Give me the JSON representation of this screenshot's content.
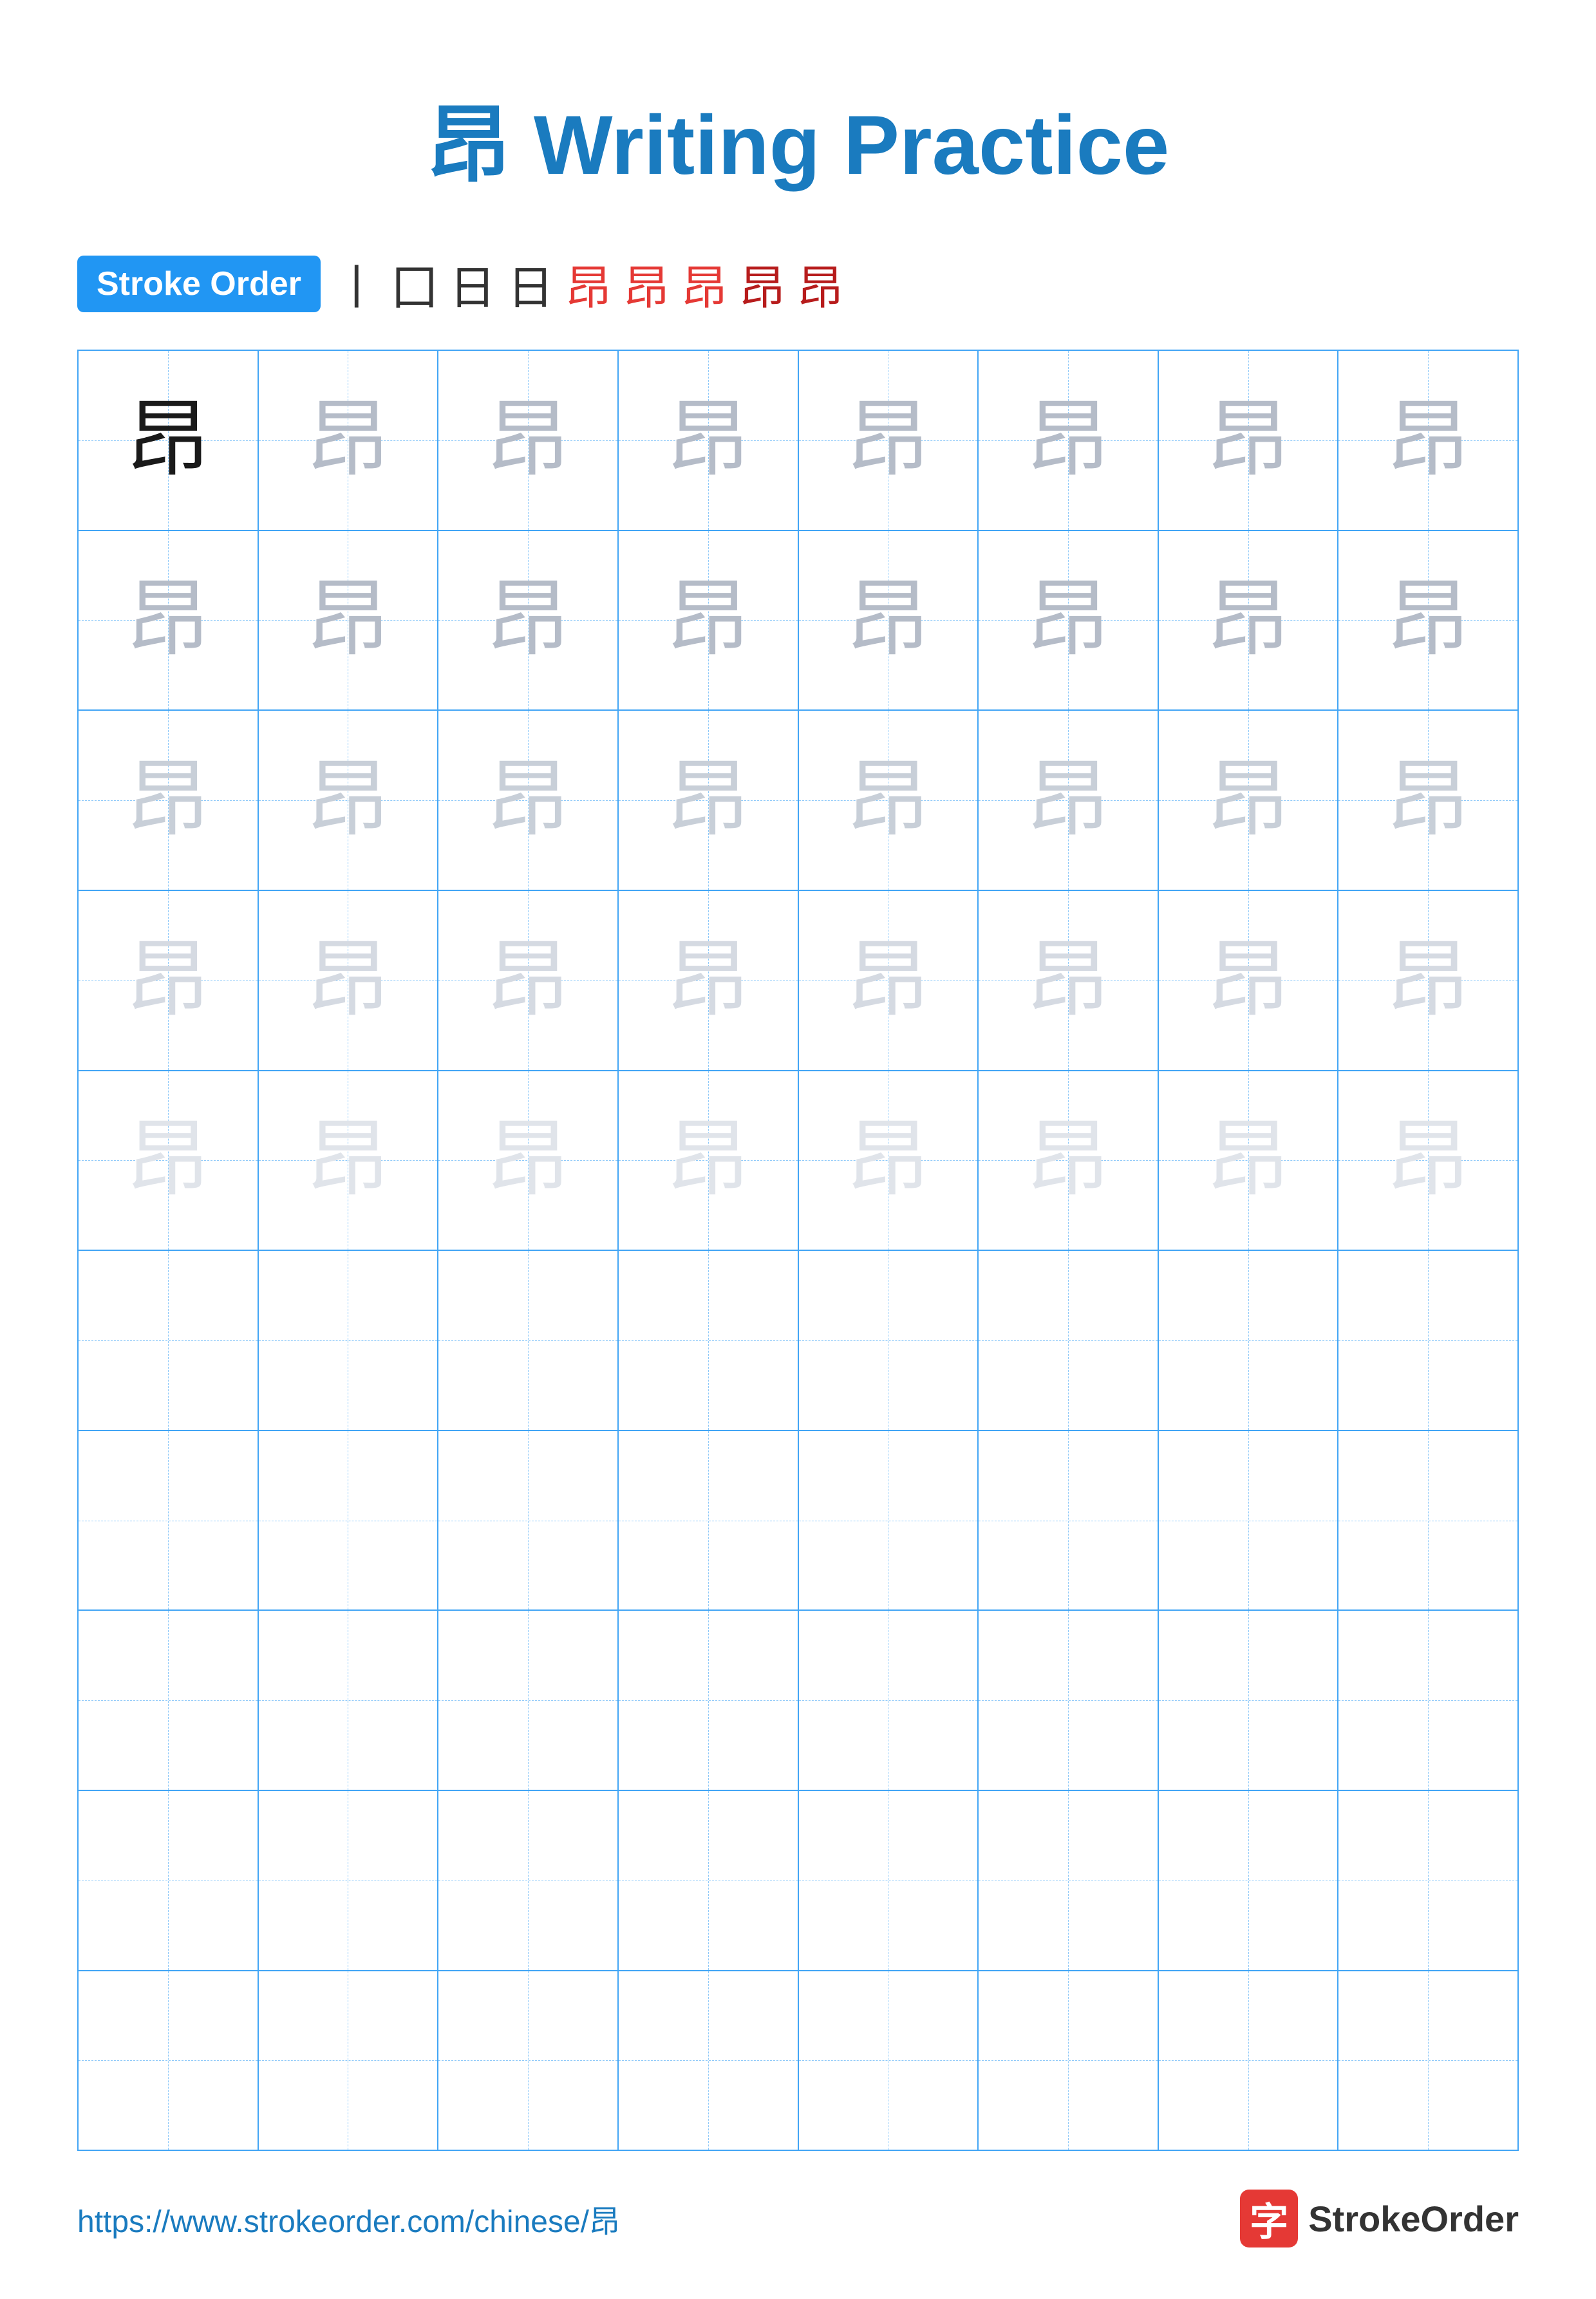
{
  "title": {
    "char": "昂",
    "text": " Writing Practice"
  },
  "stroke_order": {
    "badge_label": "Stroke Order",
    "steps": [
      "丨",
      "囗",
      "日",
      "日",
      "昂",
      "昂",
      "昂",
      "昂",
      "昂"
    ]
  },
  "grid": {
    "rows": 10,
    "cols": 8,
    "char": "昂",
    "practice_rows": [
      [
        "black",
        "gray1",
        "gray1",
        "gray1",
        "gray1",
        "gray1",
        "gray1",
        "gray1"
      ],
      [
        "gray1",
        "gray1",
        "gray1",
        "gray1",
        "gray1",
        "gray1",
        "gray1",
        "gray1"
      ],
      [
        "gray2",
        "gray2",
        "gray2",
        "gray2",
        "gray2",
        "gray2",
        "gray2",
        "gray2"
      ],
      [
        "gray3",
        "gray3",
        "gray3",
        "gray3",
        "gray3",
        "gray3",
        "gray3",
        "gray3"
      ],
      [
        "gray4",
        "gray4",
        "gray4",
        "gray4",
        "gray4",
        "gray4",
        "gray4",
        "gray4"
      ],
      [
        "empty",
        "empty",
        "empty",
        "empty",
        "empty",
        "empty",
        "empty",
        "empty"
      ],
      [
        "empty",
        "empty",
        "empty",
        "empty",
        "empty",
        "empty",
        "empty",
        "empty"
      ],
      [
        "empty",
        "empty",
        "empty",
        "empty",
        "empty",
        "empty",
        "empty",
        "empty"
      ],
      [
        "empty",
        "empty",
        "empty",
        "empty",
        "empty",
        "empty",
        "empty",
        "empty"
      ],
      [
        "empty",
        "empty",
        "empty",
        "empty",
        "empty",
        "empty",
        "empty",
        "empty"
      ]
    ]
  },
  "footer": {
    "url": "https://www.strokeorder.com/chinese/昂",
    "logo_char": "字",
    "logo_text": "StrokeOrder"
  }
}
